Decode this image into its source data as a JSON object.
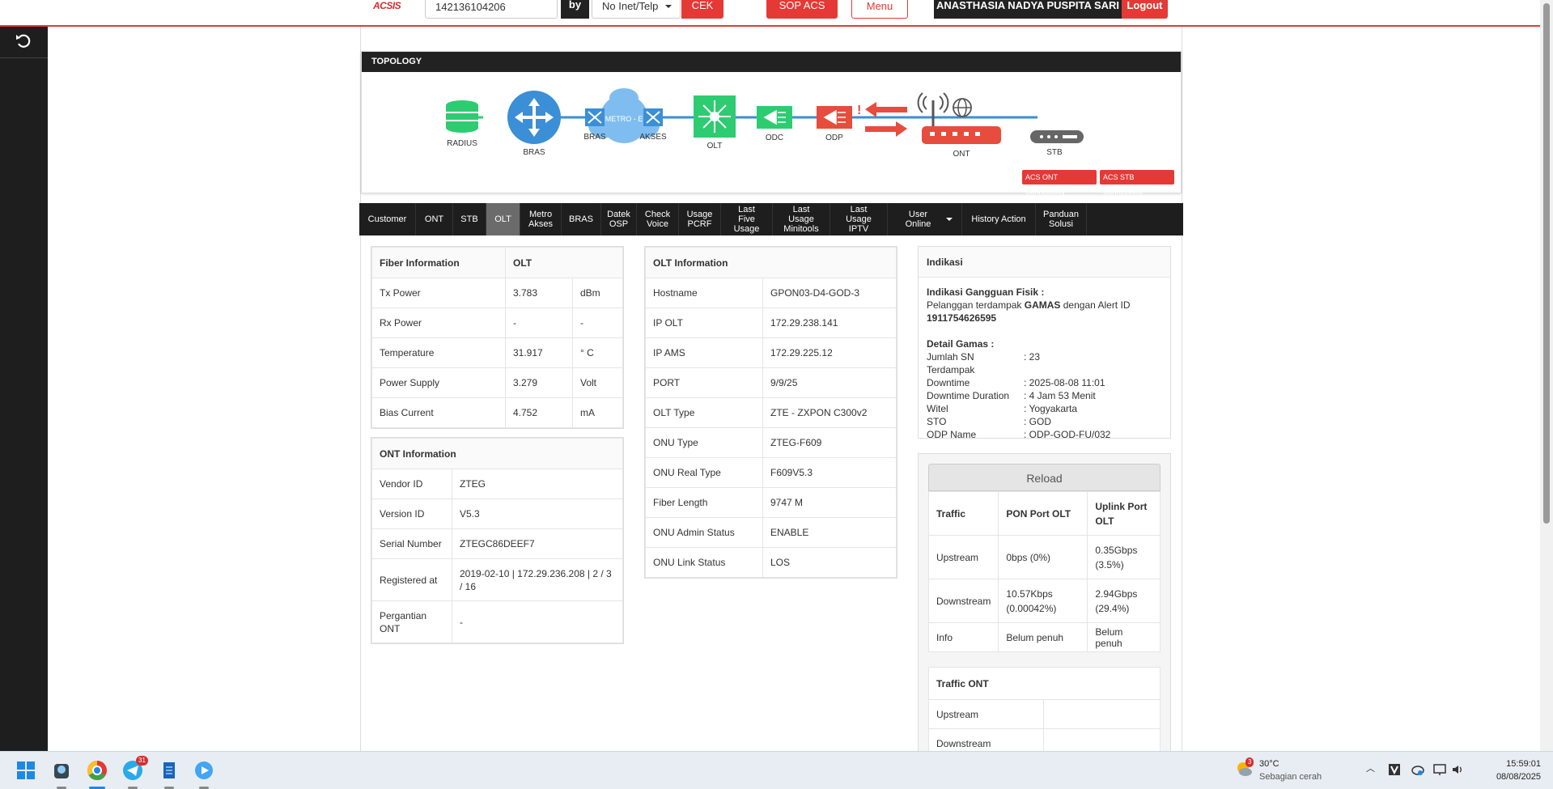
{
  "topbar": {
    "logo": "ACSIS",
    "search_value": "142136104206",
    "by_label": "by",
    "type_select": "No Inet/Telp",
    "cek_label": "CEK",
    "sop_label": "SOP ACS",
    "menu_label": "Menu",
    "user_name": "ANASTHASIA NADYA PUSPITA SARI",
    "logout_label": "Logout"
  },
  "topology": {
    "title": "TOPOLOGY",
    "nodes": [
      "RADIUS",
      "BRAS",
      "BRAS",
      "METRO - E",
      "AKSES",
      "OLT",
      "ODC",
      "ODP",
      "ONT",
      "STB"
    ],
    "acs_ont": "ACS ONT Connectivity",
    "acs_stb": "ACS STB Connectivity"
  },
  "tabs": [
    "Customer",
    "ONT",
    "STB",
    "OLT",
    "Metro\nAkses",
    "BRAS",
    "Datek\nOSP",
    "Check\nVoice",
    "Usage\nPCRF",
    "Last Five\nUsage",
    "Last Usage\nMinitools",
    "Last Usage\nIPTV",
    "User Online",
    "History Action",
    "Panduan\nSolusi"
  ],
  "active_tab": "OLT",
  "fiber": {
    "header": [
      "Fiber Information",
      "OLT"
    ],
    "rows": [
      [
        "Tx Power",
        "3.783",
        "dBm"
      ],
      [
        "Rx Power",
        "-",
        "-"
      ],
      [
        "Temperature",
        "31.917",
        "° C"
      ],
      [
        "Power Supply",
        "3.279",
        "Volt"
      ],
      [
        "Bias Current",
        "4.752",
        "mA"
      ]
    ]
  },
  "ont": {
    "header": "ONT Information",
    "rows": [
      [
        "Vendor ID",
        "ZTEG"
      ],
      [
        "Version ID",
        "V5.3"
      ],
      [
        "Serial Number",
        "ZTEGC86DEEF7"
      ],
      [
        "Registered at",
        "2019-02-10 | 172.29.236.208 | 2 / 3 / 16"
      ],
      [
        "Pergantian ONT",
        "-"
      ]
    ]
  },
  "olt": {
    "header": "OLT Information",
    "rows": [
      [
        "Hostname",
        "GPON03-D4-GOD-3"
      ],
      [
        "IP OLT",
        "172.29.238.141"
      ],
      [
        "IP AMS",
        "172.29.225.12"
      ],
      [
        "PORT",
        "9/9/25"
      ],
      [
        "OLT Type",
        "ZTE - ZXPON C300v2"
      ],
      [
        "ONU Type",
        "ZTEG-F609"
      ],
      [
        "ONU Real Type",
        "F609V5.3"
      ],
      [
        "Fiber Length",
        "9747 M"
      ],
      [
        "ONU Admin Status",
        "ENABLE"
      ],
      [
        "ONU Link Status",
        "LOS"
      ]
    ]
  },
  "indikasi": {
    "header": "Indikasi",
    "gangguan_title": "Indikasi Gangguan Fisik :",
    "gangguan_text_1": "Pelanggan terdampak ",
    "gangguan_bold": "GAMAS",
    "gangguan_text_2": " dengan Alert ID",
    "alert_id": "1911754626595",
    "detail_title": "Detail Gamas :",
    "details": [
      [
        "Jumlah SN Terdampak",
        ": 23"
      ],
      [
        "Downtime",
        ": 2025-08-08 11:01"
      ],
      [
        "Downtime Duration",
        ": 4 Jam 53 Menit"
      ],
      [
        "Witel",
        ": Yogyakarta"
      ],
      [
        "STO",
        ": GOD"
      ],
      [
        "ODP Name",
        ": ODP-GOD-FU/032"
      ]
    ]
  },
  "traffic": {
    "reload_label": "Reload",
    "header": [
      "Traffic",
      "PON Port OLT",
      "Uplink Port OLT"
    ],
    "rows": [
      [
        "Upstream",
        "0bps (0%)",
        "0.35Gbps (3.5%)"
      ],
      [
        "Downstream",
        "10.57Kbps (0.00042%)",
        "2.94Gbps (29.4%)"
      ],
      [
        "Info",
        "Belum penuh",
        "Belum penuh"
      ]
    ]
  },
  "traffic_ont": {
    "header": "Traffic ONT",
    "rows": [
      [
        "Upstream",
        ""
      ],
      [
        "Downstream",
        ""
      ]
    ]
  },
  "taskbar": {
    "telegram_badge": "31",
    "weather_badge": "3",
    "temp": "30°C",
    "condition": "Sebagian cerah",
    "time": "15:59:01",
    "date": "08/08/2025"
  }
}
